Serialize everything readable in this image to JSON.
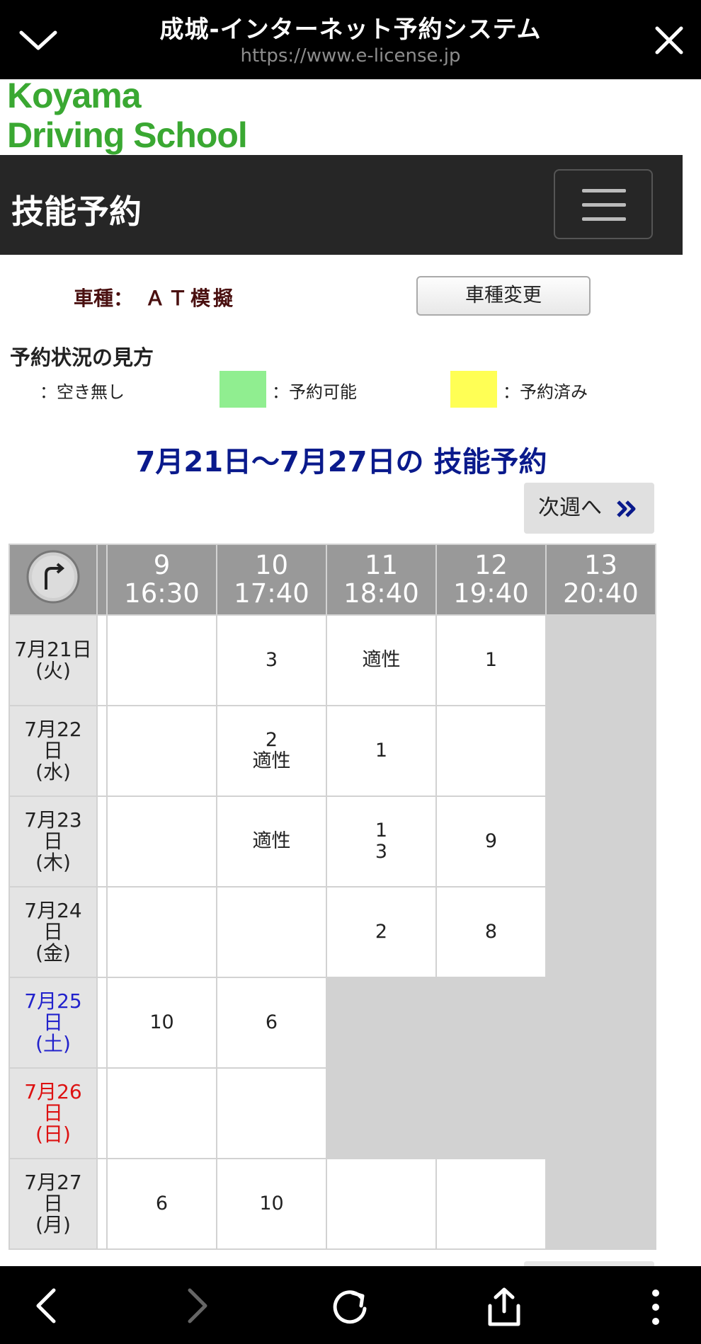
{
  "browser": {
    "title": "成城-インターネット予約システム",
    "url": "https://www.e-license.jp"
  },
  "logo": {
    "line1": "Koyama",
    "line2": "Driving School",
    "color": "#3aa832"
  },
  "header": {
    "title": "技能予約"
  },
  "vehicle": {
    "label": "車種：",
    "value": "ＡＴ模擬",
    "change_button": "車種変更"
  },
  "legend": {
    "title": "予約状況の見方",
    "items": [
      {
        "label": "：空き無し",
        "color": "#ffffff"
      },
      {
        "label": "：予約可能",
        "color": "#90ee90"
      },
      {
        "label": "：予約済み",
        "color": "#ffff55"
      }
    ]
  },
  "week": {
    "title": "7月21日〜7月27日の 技能予約",
    "next_button": "次週へ"
  },
  "schedule": {
    "periods": [
      {
        "no": "9",
        "time": "16:30"
      },
      {
        "no": "10",
        "time": "17:40"
      },
      {
        "no": "11",
        "time": "18:40"
      },
      {
        "no": "12",
        "time": "19:40"
      },
      {
        "no": "13",
        "time": "20:40"
      }
    ],
    "days": [
      {
        "line1": "7月21日",
        "line2": "(火)",
        "line3": "",
        "weekday": "weekday",
        "cells": [
          {
            "text": [
              "",
              ""
            ],
            "gray": false
          },
          {
            "text": [
              "3",
              ""
            ],
            "gray": false
          },
          {
            "text": [
              "適性",
              ""
            ],
            "gray": false
          },
          {
            "text": [
              "1",
              ""
            ],
            "gray": false
          },
          {
            "text": [
              "",
              ""
            ],
            "gray": true
          }
        ]
      },
      {
        "line1": "7月22",
        "line2": "日",
        "line3": "(水)",
        "weekday": "weekday",
        "cells": [
          {
            "text": [
              "",
              ""
            ],
            "gray": false
          },
          {
            "text": [
              "2",
              "適性"
            ],
            "gray": false
          },
          {
            "text": [
              "1",
              ""
            ],
            "gray": false
          },
          {
            "text": [
              "",
              ""
            ],
            "gray": false
          },
          {
            "text": [
              "",
              ""
            ],
            "gray": true
          }
        ]
      },
      {
        "line1": "7月23",
        "line2": "日",
        "line3": "(木)",
        "weekday": "weekday",
        "cells": [
          {
            "text": [
              "",
              ""
            ],
            "gray": false
          },
          {
            "text": [
              "適性",
              ""
            ],
            "gray": false
          },
          {
            "text": [
              "1",
              "3"
            ],
            "gray": false
          },
          {
            "text": [
              "9",
              ""
            ],
            "gray": false
          },
          {
            "text": [
              "",
              ""
            ],
            "gray": true
          }
        ]
      },
      {
        "line1": "7月24",
        "line2": "日",
        "line3": "(金)",
        "weekday": "weekday",
        "cells": [
          {
            "text": [
              "",
              ""
            ],
            "gray": false
          },
          {
            "text": [
              "",
              ""
            ],
            "gray": false
          },
          {
            "text": [
              "2",
              ""
            ],
            "gray": false
          },
          {
            "text": [
              "8",
              ""
            ],
            "gray": false
          },
          {
            "text": [
              "",
              ""
            ],
            "gray": true
          }
        ]
      },
      {
        "line1": "7月25",
        "line2": "日",
        "line3": "(土)",
        "weekday": "sat",
        "cells": [
          {
            "text": [
              "10",
              ""
            ],
            "gray": false
          },
          {
            "text": [
              "6",
              ""
            ],
            "gray": false
          },
          {
            "text": [
              "",
              ""
            ],
            "gray": true
          },
          {
            "text": [
              "",
              ""
            ],
            "gray": true
          },
          {
            "text": [
              "",
              ""
            ],
            "gray": true
          }
        ]
      },
      {
        "line1": "7月26",
        "line2": "日",
        "line3": "(日)",
        "weekday": "sun",
        "cells": [
          {
            "text": [
              "",
              ""
            ],
            "gray": false
          },
          {
            "text": [
              "",
              ""
            ],
            "gray": false
          },
          {
            "text": [
              "",
              ""
            ],
            "gray": true
          },
          {
            "text": [
              "",
              ""
            ],
            "gray": true
          },
          {
            "text": [
              "",
              ""
            ],
            "gray": true
          }
        ]
      },
      {
        "line1": "7月27",
        "line2": "日",
        "line3": "(月)",
        "weekday": "weekday",
        "cells": [
          {
            "text": [
              "6",
              ""
            ],
            "gray": false
          },
          {
            "text": [
              "10",
              ""
            ],
            "gray": false
          },
          {
            "text": [
              "",
              ""
            ],
            "gray": false
          },
          {
            "text": [
              "",
              ""
            ],
            "gray": false
          },
          {
            "text": [
              "",
              ""
            ],
            "gray": true
          }
        ]
      }
    ]
  },
  "icons": {
    "top_left": "chevron-down-icon",
    "top_right": "close-icon",
    "header_menu": "hamburger-menu-icon",
    "table_corner": "refresh-arrow-icon",
    "bottom": [
      "back-icon",
      "forward-icon",
      "reload-icon",
      "share-icon",
      "more-icon"
    ]
  }
}
